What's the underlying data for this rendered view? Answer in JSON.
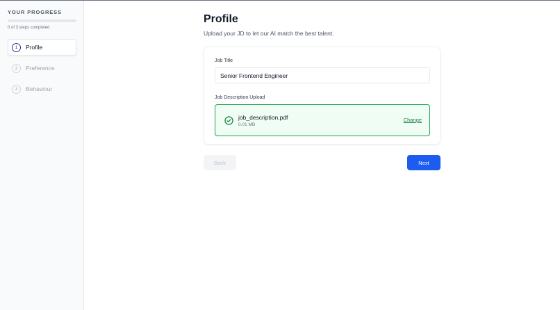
{
  "sidebar": {
    "heading": "YOUR PROGRESS",
    "progress_fraction": 0,
    "progress_text": "0 of 3 steps completed",
    "steps": [
      {
        "number": "1",
        "label": "Profile",
        "active": true
      },
      {
        "number": "2",
        "label": "Preference",
        "active": false
      },
      {
        "number": "3",
        "label": "Behaviour",
        "active": false
      }
    ]
  },
  "main": {
    "title": "Profile",
    "subtitle": "Upload your JD to let our AI match the best talent.",
    "job_title": {
      "label": "Job Title",
      "value": "Senior Frontend Engineer"
    },
    "upload": {
      "label": "Job Description Upload",
      "file_name": "job_description.pdf",
      "file_size": "0.01 MB",
      "change_label": "Change",
      "icon": "check-circle-icon"
    },
    "back_label": "Back",
    "next_label": "Next"
  },
  "colors": {
    "accent": "#1d5cf0",
    "success": "#16a34a",
    "success_bg": "#f0fdf4"
  }
}
